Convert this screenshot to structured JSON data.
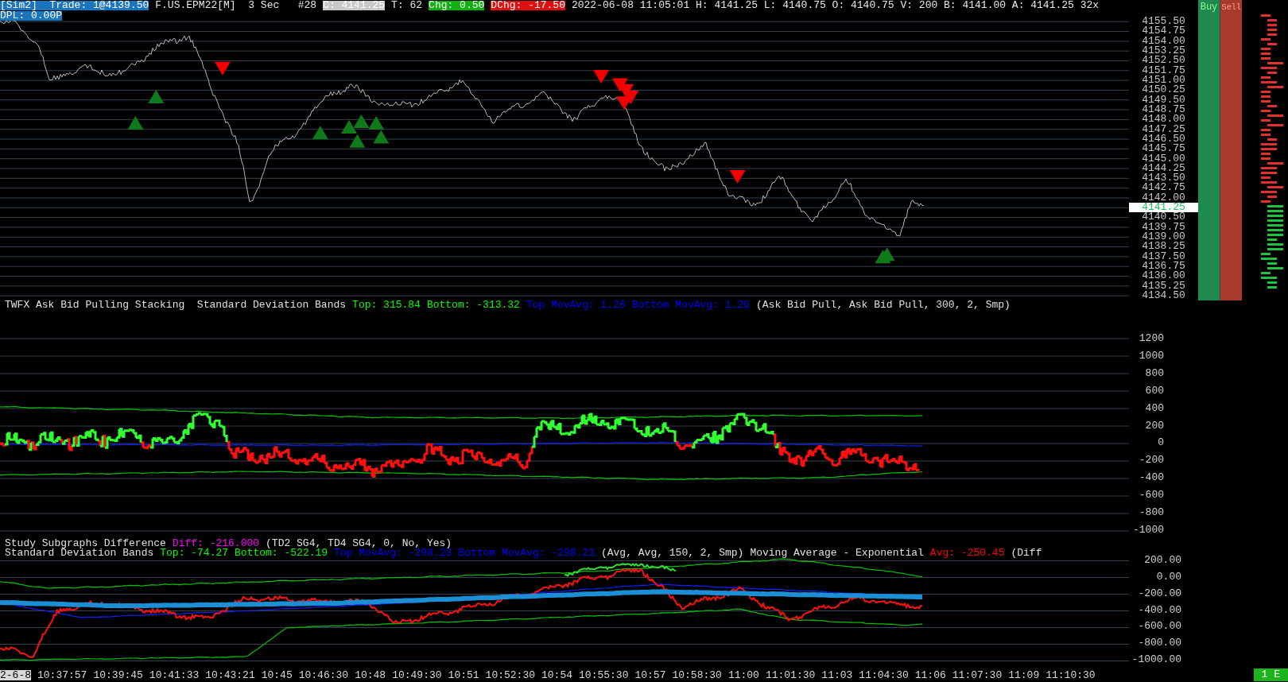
{
  "header": {
    "segments": [
      {
        "text": "[Sim2]  Trade: 1@4139.50",
        "color": "#1b75bc"
      },
      {
        "text": "F.US.EPM22[M]  3 Sec   #28"
      },
      {
        "text": "C: 4141.25",
        "color": "#c8c8c8"
      },
      {
        "text": "T: 62"
      },
      {
        "text": "Chg: 0.50",
        "color": "#10b010"
      },
      {
        "text": "DChg: -17.50",
        "color": "#e01010"
      },
      {
        "text": "2022-06-08 11:05:01 H: 4141.25 L: 4140.75 O: 4140.75 V: 200 B: 4141.00 A: 4141.25 32x"
      }
    ],
    "dpl": {
      "text": "DPL: 0.00P",
      "color": "#1b75bc"
    }
  },
  "price_panel": {
    "axis": [
      {
        "text": "4155.50",
        "selected": false
      },
      {
        "text": "4154.75",
        "selected": false
      },
      {
        "text": "4154.00",
        "selected": false
      },
      {
        "text": "4153.25",
        "selected": false
      },
      {
        "text": "4152.50",
        "selected": false
      },
      {
        "text": "4151.75",
        "selected": false
      },
      {
        "text": "4151.00",
        "selected": false
      },
      {
        "text": "4150.25",
        "selected": false
      },
      {
        "text": "4149.50",
        "selected": false
      },
      {
        "text": "4148.75",
        "selected": false
      },
      {
        "text": "4148.00",
        "selected": false
      },
      {
        "text": "4147.25",
        "selected": false
      },
      {
        "text": "4146.50",
        "selected": false
      },
      {
        "text": "4145.75",
        "selected": false
      },
      {
        "text": "4145.00",
        "selected": false
      },
      {
        "text": "4144.25",
        "selected": false
      },
      {
        "text": "4143.50",
        "selected": false
      },
      {
        "text": "4142.75",
        "selected": false
      },
      {
        "text": "4142.00",
        "selected": false
      },
      {
        "text": "4141.25",
        "selected": true
      },
      {
        "text": "4140.50",
        "selected": false
      },
      {
        "text": "4139.75",
        "selected": false
      },
      {
        "text": "4139.00",
        "selected": false
      },
      {
        "text": "4138.25",
        "selected": false
      },
      {
        "text": "4137.50",
        "selected": false
      },
      {
        "text": "4136.75",
        "selected": false
      },
      {
        "text": "4136.00",
        "selected": false
      },
      {
        "text": "4135.25",
        "selected": false
      },
      {
        "text": "4134.50",
        "selected": false
      }
    ],
    "buy_label": "Buy",
    "sell_label": "Sell"
  },
  "oscillator_panel": {
    "title": [
      {
        "text": "TWFX Ask Bid Pulling Stacking  Standard Deviation Bands",
        "color": "#e0e0e0"
      },
      {
        "text": "Top: 315.84",
        "color": "#00ff00"
      },
      {
        "text": "Bottom: -313.32",
        "color": "#00ff00"
      },
      {
        "text": "Top MovAvg: 1.26",
        "color": "#0000ff"
      },
      {
        "text": "Bottom MovAvg: 1.26",
        "color": "#0000ff"
      },
      {
        "text": "(Ask Bid Pull, Ask Bid Pull, 300, 2, Smp)",
        "color": "#e0e0e0"
      }
    ],
    "axis": [
      "1200",
      "1000",
      "800",
      "600",
      "400",
      "200",
      "0",
      "-200",
      "-400",
      "-600",
      "-800",
      "-1000"
    ]
  },
  "difference_panel": {
    "title_lines": [
      [
        {
          "text": "Study Subgraphs Difference",
          "color": "#e0e0e0"
        },
        {
          "text": "Diff: -216.000",
          "color": "#ff00ff"
        },
        {
          "text": "(TD2 SG4, TD4 SG4, 0, No, Yes)",
          "color": "#e0e0e0"
        }
      ],
      [
        {
          "text": "Standard Deviation Bands",
          "color": "#e0e0e0"
        },
        {
          "text": "Top: -74.27",
          "color": "#00ff00"
        },
        {
          "text": "Bottom: -522.19",
          "color": "#00ff00"
        },
        {
          "text": "Top MovAvg: -298.23",
          "color": "#0000ff"
        },
        {
          "text": "Bottom MovAvg: -298.23",
          "color": "#0000ff"
        },
        {
          "text": "(Avg, Avg, 150, 2, Smp)",
          "color": "#e0e0e0"
        },
        {
          "text": "Moving Average - Exponential",
          "color": "#e0e0e0"
        },
        {
          "text": "Avg: -250.45",
          "color": "#ff0000"
        },
        {
          "text": "(Diff",
          "color": "#e0e0e0"
        }
      ]
    ],
    "axis": [
      "200.00",
      "0.00",
      "-200.00",
      "-400.00",
      "-600.00",
      "-800.00",
      "-1000.00"
    ]
  },
  "time_axis": [
    {
      "text": "2-6-8",
      "selected": true
    },
    {
      "text": "10:37:57",
      "selected": false
    },
    {
      "text": "10:39:45",
      "selected": false
    },
    {
      "text": "10:41:33",
      "selected": false
    },
    {
      "text": "10:43:21",
      "selected": false
    },
    {
      "text": "10:45",
      "selected": false
    },
    {
      "text": "10:46:30",
      "selected": false
    },
    {
      "text": "10:48",
      "selected": false
    },
    {
      "text": "10:49:30",
      "selected": false
    },
    {
      "text": "10:51",
      "selected": false
    },
    {
      "text": "10:52:30",
      "selected": false
    },
    {
      "text": "10:54",
      "selected": false
    },
    {
      "text": "10:55:30",
      "selected": false
    },
    {
      "text": "10:57",
      "selected": false
    },
    {
      "text": "10:58:30",
      "selected": false
    },
    {
      "text": "11:00",
      "selected": false
    },
    {
      "text": "11:01:30",
      "selected": false
    },
    {
      "text": "11:03",
      "selected": false
    },
    {
      "text": "11:04:30",
      "selected": false
    },
    {
      "text": "11:06",
      "selected": false
    },
    {
      "text": "11:07:30",
      "selected": false
    },
    {
      "text": "11:09",
      "selected": false
    },
    {
      "text": "11:10:30",
      "selected": false
    }
  ],
  "status": "1 E"
}
